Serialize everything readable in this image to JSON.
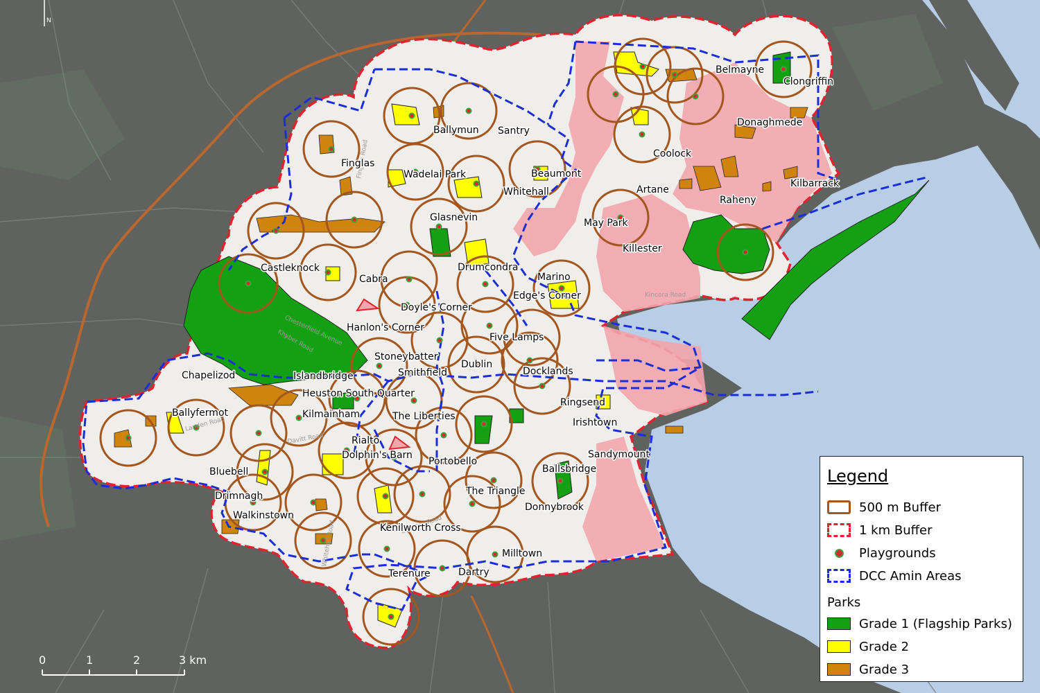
{
  "north_label": "N",
  "places": [
    {
      "name": "Finglas"
    },
    {
      "name": "Ballymun"
    },
    {
      "name": "Santry"
    },
    {
      "name": "Wadelai Park"
    },
    {
      "name": "Beaumont"
    },
    {
      "name": "Whitehall"
    },
    {
      "name": "Glasnevin"
    },
    {
      "name": "Coolock"
    },
    {
      "name": "Belmayne"
    },
    {
      "name": "Clongriffin"
    },
    {
      "name": "Donaghmede"
    },
    {
      "name": "Kilbarrack"
    },
    {
      "name": "Artane"
    },
    {
      "name": "Raheny"
    },
    {
      "name": "May Park"
    },
    {
      "name": "Killester"
    },
    {
      "name": "Castleknock"
    },
    {
      "name": "Cabra"
    },
    {
      "name": "Drumcondra"
    },
    {
      "name": "Marino"
    },
    {
      "name": "Edge's Corner"
    },
    {
      "name": "Doyle's Corner"
    },
    {
      "name": "Hanlon's Corner"
    },
    {
      "name": "Five Lamps"
    },
    {
      "name": "Stoneybatter"
    },
    {
      "name": "Smithfield"
    },
    {
      "name": "Dublin"
    },
    {
      "name": "Docklands"
    },
    {
      "name": "Chapelizod"
    },
    {
      "name": "Islandbridge"
    },
    {
      "name": "Heuston South Quarter"
    },
    {
      "name": "Ballyfermot"
    },
    {
      "name": "Kilmainham"
    },
    {
      "name": "The Liberties"
    },
    {
      "name": "Ringsend"
    },
    {
      "name": "Irishtown"
    },
    {
      "name": "Rialto"
    },
    {
      "name": "Dolphin's Barn"
    },
    {
      "name": "Portobello"
    },
    {
      "name": "Sandymount"
    },
    {
      "name": "Ballsbridge"
    },
    {
      "name": "Bluebell"
    },
    {
      "name": "Drimnagh"
    },
    {
      "name": "The Triangle"
    },
    {
      "name": "Donnybrook"
    },
    {
      "name": "Walkinstown"
    },
    {
      "name": "Kenilworth Cross"
    },
    {
      "name": "Milltown"
    },
    {
      "name": "Terenure"
    },
    {
      "name": "Dartry"
    }
  ],
  "road_labels": [
    "Finglas Road",
    "Landen Road",
    "Davitt Road",
    "Kincora Road",
    "Chesterfield Avenue",
    "Khyber Road",
    "Whitehall Road",
    "Leinster Road"
  ],
  "scale_bar": {
    "labels": [
      "0",
      "1",
      "2",
      "3 km"
    ]
  },
  "legend": {
    "title": "Legend",
    "items": [
      {
        "label": "500 m Buffer",
        "symbol": "buffer-500"
      },
      {
        "label": "1 km Buffer",
        "symbol": "buffer-1km"
      },
      {
        "label": "Playgrounds",
        "symbol": "playground"
      },
      {
        "label": "DCC Amin Areas",
        "symbol": "dcc-area"
      }
    ],
    "parks_heading": "Parks",
    "parks": [
      {
        "label": "Grade 1 (Flagship Parks)",
        "color": "#13a113"
      },
      {
        "label": "Grade 2",
        "color": "#ffff00"
      },
      {
        "label": "Grade 3",
        "color": "#d0840f"
      }
    ]
  },
  "colors": {
    "land": "#5f625f",
    "water": "#b8cde6",
    "buffer_fill": "#f0eeeb",
    "buffer500": "#a4561f",
    "buffer1km": "#e0232e",
    "dcc": "#1b2ed6",
    "uncovered": "#f2a6ad",
    "playground_fill": "#e0232e",
    "playground_ring": "#3aa63a"
  }
}
